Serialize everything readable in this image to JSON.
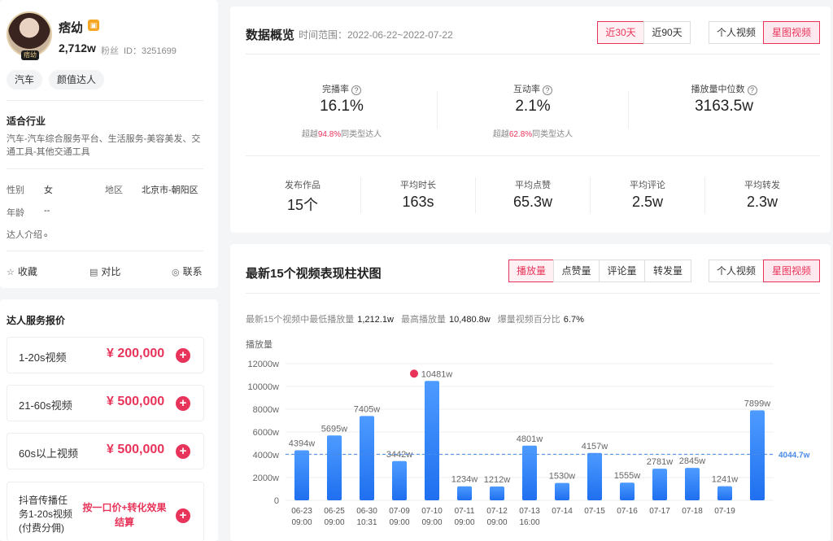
{
  "profile": {
    "name": "痞幼",
    "avatar_badge": "痞幼",
    "shop_icon": "shop-icon",
    "fans_count": "2,712w",
    "fans_label": "粉丝",
    "id_text": "ID：3251699",
    "tags": [
      "汽车",
      "颜值达人"
    ],
    "industry_title": "适合行业",
    "industry_text": "汽车-汽车综合服务平台、生活服务-美容美发、交通工具-其他交通工具",
    "gender_label": "性别",
    "gender_value": "女",
    "region_label": "地区",
    "region_value": "北京市-朝阳区",
    "age_label": "年龄",
    "age_value": "--",
    "intro_label": "达人介绍",
    "intro_value": "。",
    "actions": {
      "favorite": "收藏",
      "compare": "对比",
      "contact": "联系"
    }
  },
  "pricing": {
    "title": "达人服务报价",
    "items": [
      {
        "label": "1-20s视频",
        "price": "¥ 200,000"
      },
      {
        "label": "21-60s视频",
        "price": "¥ 500,000"
      },
      {
        "label": "60s以上视频",
        "price": "¥ 500,000"
      }
    ],
    "special": {
      "label_lines": [
        "抖音传播任",
        "务1-20s视频",
        "(付费分佣)"
      ],
      "note_lines": [
        "按一口价+转化效果",
        "结算"
      ]
    }
  },
  "overview": {
    "title": "数据概览",
    "range": "时间范围：2022-06-22~2022-07-22",
    "period_buttons": [
      "近30天",
      "近90天"
    ],
    "video_buttons": [
      "个人视频",
      "星图视频"
    ],
    "metrics": [
      {
        "label": "完播率",
        "value": "16.1%",
        "sub_prefix": "超越",
        "sub_highlight": "94.8%",
        "sub_suffix": "同类型达人"
      },
      {
        "label": "互动率",
        "value": "2.1%",
        "sub_prefix": "超越",
        "sub_highlight": "62.8%",
        "sub_suffix": "同类型达人"
      },
      {
        "label": "播放量中位数",
        "value": "3163.5w"
      }
    ],
    "stats": [
      {
        "label": "发布作品",
        "value": "15个"
      },
      {
        "label": "平均时长",
        "value": "163s"
      },
      {
        "label": "平均点赞",
        "value": "65.3w"
      },
      {
        "label": "平均评论",
        "value": "2.5w"
      },
      {
        "label": "平均转发",
        "value": "2.3w"
      }
    ]
  },
  "chart_panel": {
    "title": "最新15个视频表现柱状图",
    "metric_tabs": [
      "播放量",
      "点赞量",
      "评论量",
      "转发量"
    ],
    "video_buttons": [
      "个人视频",
      "星图视频"
    ],
    "summary": {
      "min_label": "最新15个视频中最低播放量",
      "min_value": "1,212.1w",
      "max_label": "最高播放量",
      "max_value": "10,480.8w",
      "ratio_label": "爆量视频百分比",
      "ratio_value": "6.7%"
    },
    "y_axis_label": "播放量"
  },
  "colors": {
    "accent": "#e8345a",
    "bar_top": "#4d9bff",
    "bar_bottom": "#1f6ff0",
    "avg_line": "#4a8be8"
  },
  "chart_data": {
    "type": "bar",
    "ylabel": "播放量",
    "ylim": [
      0,
      12000
    ],
    "yticks": [
      "0",
      "2000w",
      "4000w",
      "6000w",
      "8000w",
      "10000w",
      "12000w"
    ],
    "categories": [
      [
        "06-23",
        "09:00"
      ],
      [
        "06-25",
        "09:00"
      ],
      [
        "06-30",
        "10:31"
      ],
      [
        "07-09",
        "09:00"
      ],
      [
        "07-10",
        "09:00"
      ],
      [
        "07-11",
        "09:00"
      ],
      [
        "07-12",
        "09:00"
      ],
      [
        "07-13",
        "16:00"
      ],
      [
        "07-14",
        ""
      ],
      [
        "07-15",
        ""
      ],
      [
        "07-16",
        ""
      ],
      [
        "07-17",
        ""
      ],
      [
        "07-18",
        ""
      ],
      [
        "07-19",
        ""
      ],
      [
        "",
        ""
      ]
    ],
    "values": [
      4394,
      5695,
      7405,
      3442,
      10481,
      1234,
      1212,
      4801,
      1530,
      4157,
      1555,
      2781,
      2845,
      1241,
      7899
    ],
    "value_labels": [
      "4394w",
      "5695w",
      "7405w",
      "3442w",
      "10481w",
      "1234w",
      "1212w",
      "4801w",
      "1530w",
      "4157w",
      "1555w",
      "2781w",
      "2845w",
      "1241w",
      "7899w"
    ],
    "average": 4044.7,
    "average_label": "4044.7w",
    "peak_index": 4
  }
}
